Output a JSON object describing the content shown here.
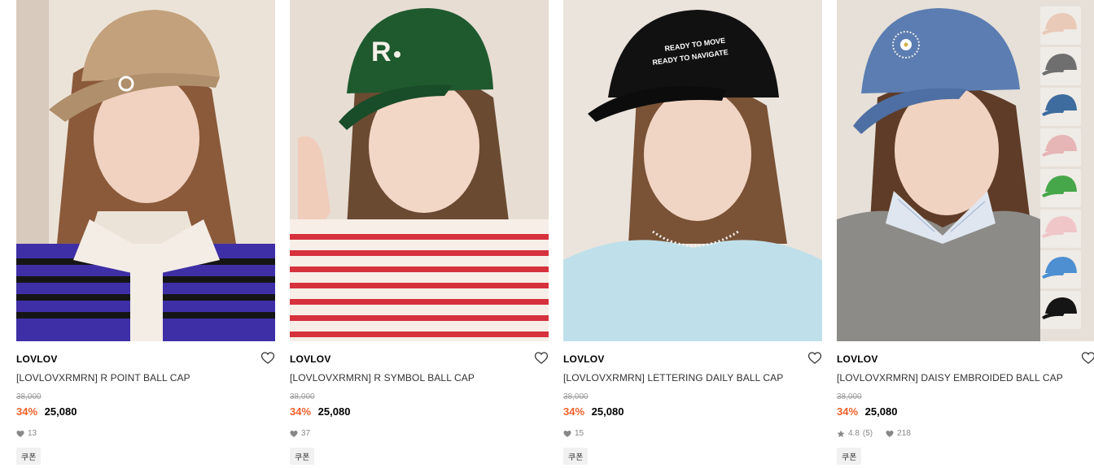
{
  "products": [
    {
      "brand": "LOVLOV",
      "name": "[LOVLOVXRMRN] R POINT BALL CAP",
      "original_price": "38,000",
      "discount": "34%",
      "sale_price": "25,080",
      "likes": "13",
      "coupon": "쿠폰",
      "cap_color": "#c2a17c",
      "top_color": "#3f2fa6",
      "bg_color": "#ece3d8"
    },
    {
      "brand": "LOVLOV",
      "name": "[LOVLOVXRMRN] R SYMBOL BALL CAP",
      "original_price": "38,000",
      "discount": "34%",
      "sale_price": "25,080",
      "likes": "37",
      "coupon": "쿠폰",
      "cap_color": "#1f5a2f",
      "top_color": "#f6eee7",
      "bg_color": "#e7ddd3"
    },
    {
      "brand": "LOVLOV",
      "name": "[LOVLOVXRMRN] LETTERING DAILY BALL CAP",
      "original_price": "38,000",
      "discount": "34%",
      "sale_price": "25,080",
      "likes": "15",
      "coupon": "쿠폰",
      "cap_color": "#111111",
      "top_color": "#bfe0ea",
      "bg_color": "#ebe4dc"
    },
    {
      "brand": "LOVLOV",
      "name": "[LOVLOVXRMRN] DAISY EMBROIDED BALL CAP",
      "original_price": "38,000",
      "discount": "34%",
      "sale_price": "25,080",
      "rating": "4.8",
      "reviews": "(5)",
      "likes": "218",
      "coupon": "쿠폰",
      "cap_color": "#5b7db2",
      "top_color": "#8d8b88",
      "bg_color": "#e6e0d8",
      "color_swatches": [
        "#e9c9b8",
        "#6f6f6f",
        "#3f6c9f",
        "#e6b5b5",
        "#46a74a",
        "#f0c6c8",
        "#4d8fd1",
        "#151515"
      ]
    }
  ],
  "icons": {
    "wishlist": "heart-outline-icon",
    "likes": "heart-filled-icon",
    "rating": "star-icon"
  }
}
